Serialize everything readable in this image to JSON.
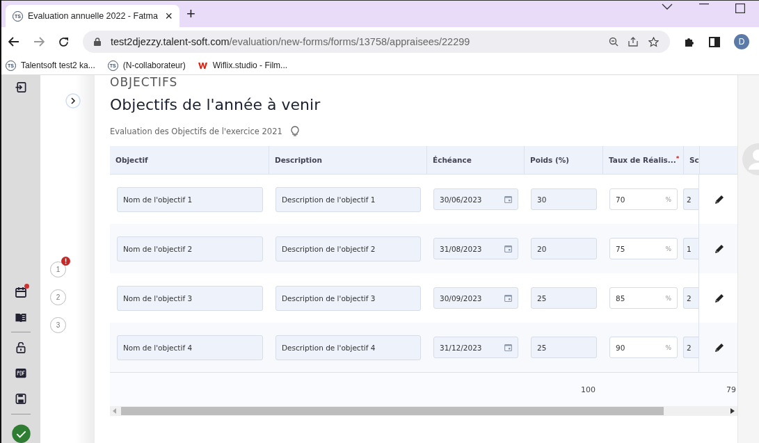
{
  "browser": {
    "tab": {
      "favicon": "TS",
      "title": "Evaluation annuelle 2022 - Fatma",
      "close": "×"
    },
    "new_tab": "+",
    "url_host": "test2djezzy.talent-soft.com",
    "url_path": "/evaluation/new-forms/forms/13758/appraisees/22299",
    "profile": "D",
    "bookmarks": [
      {
        "kind": "ts",
        "favicon": "TS",
        "label": "Talentsoft test2 ka..."
      },
      {
        "kind": "ts",
        "favicon": "TS",
        "label": "(N-collaborateur)"
      },
      {
        "kind": "w",
        "label": "Wiflix.studio - Film..."
      }
    ]
  },
  "rail": {
    "calendar_alert": true
  },
  "steps": [
    {
      "number": "1",
      "alert": true
    },
    {
      "number": "2",
      "alert": false
    },
    {
      "number": "3",
      "alert": false
    }
  ],
  "section_title": "OBJECTIFS",
  "heading": "Objectifs de l'année à venir",
  "subheading": "Evaluation des Objectifs de l'exercice 2021",
  "table": {
    "columns": [
      {
        "label": "Objectif"
      },
      {
        "label": "Description"
      },
      {
        "label": "Échéance"
      },
      {
        "label": "Poids (%)"
      },
      {
        "label": "Taux de Réalis...",
        "required_mark": "*"
      },
      {
        "label": "Sc"
      }
    ],
    "rows": [
      {
        "objective": "Nom de l'objectif 1",
        "description": "Description de l'objectif 1",
        "due": "30/06/2023",
        "weight": "30",
        "rate": "70",
        "unit": "%",
        "score": "2"
      },
      {
        "objective": "Nom de l'objectif 2",
        "description": "Description de l'objectif 2",
        "due": "31/08/2023",
        "weight": "20",
        "rate": "75",
        "unit": "%",
        "score": "1"
      },
      {
        "objective": "Nom de l'objectif 3",
        "description": "Description de l'objectif 3",
        "due": "30/09/2023",
        "weight": "25",
        "rate": "85",
        "unit": "%",
        "score": "2"
      },
      {
        "objective": "Nom de l'objectif 4",
        "description": "Description de l'objectif 4",
        "due": "31/12/2023",
        "weight": "25",
        "rate": "90",
        "unit": "%",
        "score": "2"
      }
    ],
    "totals": {
      "weight": "100",
      "score": "79"
    }
  }
}
